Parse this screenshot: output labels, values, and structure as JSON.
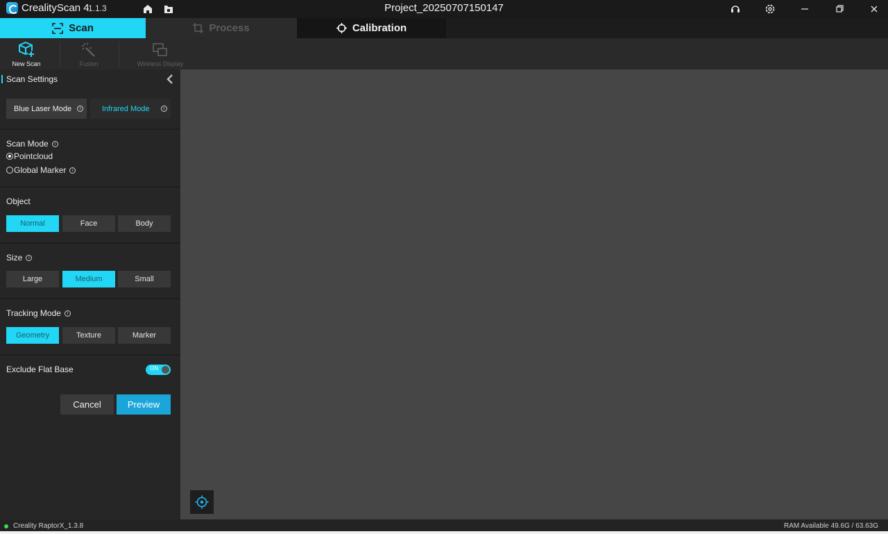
{
  "titlebar": {
    "app_name": "CrealityScan 4",
    "version": "1.1.3",
    "project_title": "Project_20250707150147",
    "icons": [
      "home-icon",
      "folder-icon",
      "headset-icon",
      "gear-icon",
      "minimize-icon",
      "restore-icon",
      "close-icon"
    ]
  },
  "tabs": {
    "scan": "Scan",
    "process": "Process",
    "calibration": "Calibration"
  },
  "toolbar": {
    "new_scan": "New Scan",
    "fusion": "Fusion",
    "wireless_display": "Wireless Display"
  },
  "panel": {
    "title": "Scan Settings",
    "modes": {
      "blue_laser": "Blue Laser Mode",
      "infrared": "Infrared Mode",
      "selected": "Infrared Mode"
    },
    "scan_mode": {
      "label": "Scan Mode",
      "options": [
        "Pointcloud",
        "Global Marker"
      ],
      "selected": "Pointcloud"
    },
    "object": {
      "label": "Object",
      "options": [
        "Normal",
        "Face",
        "Body"
      ],
      "selected": "Normal"
    },
    "size": {
      "label": "Size",
      "options": [
        "Large",
        "Medium",
        "Small"
      ],
      "selected": "Medium"
    },
    "tracking_mode": {
      "label": "Tracking Mode",
      "options": [
        "Geometry",
        "Texture",
        "Marker"
      ],
      "selected": "Geometry"
    },
    "exclude_flat_base": {
      "label": "Exclude Flat Base",
      "state": "ON"
    },
    "buttons": {
      "cancel": "Cancel",
      "preview": "Preview"
    }
  },
  "statusbar": {
    "device": "Creality RaptorX_1.3.8",
    "ram": "RAM Available 49.6G / 63.63G"
  },
  "colors": {
    "accent": "#22d6f5",
    "preview_button": "#1aa6d9",
    "viewport": "#464646",
    "status_dot": "#3ddc55"
  }
}
